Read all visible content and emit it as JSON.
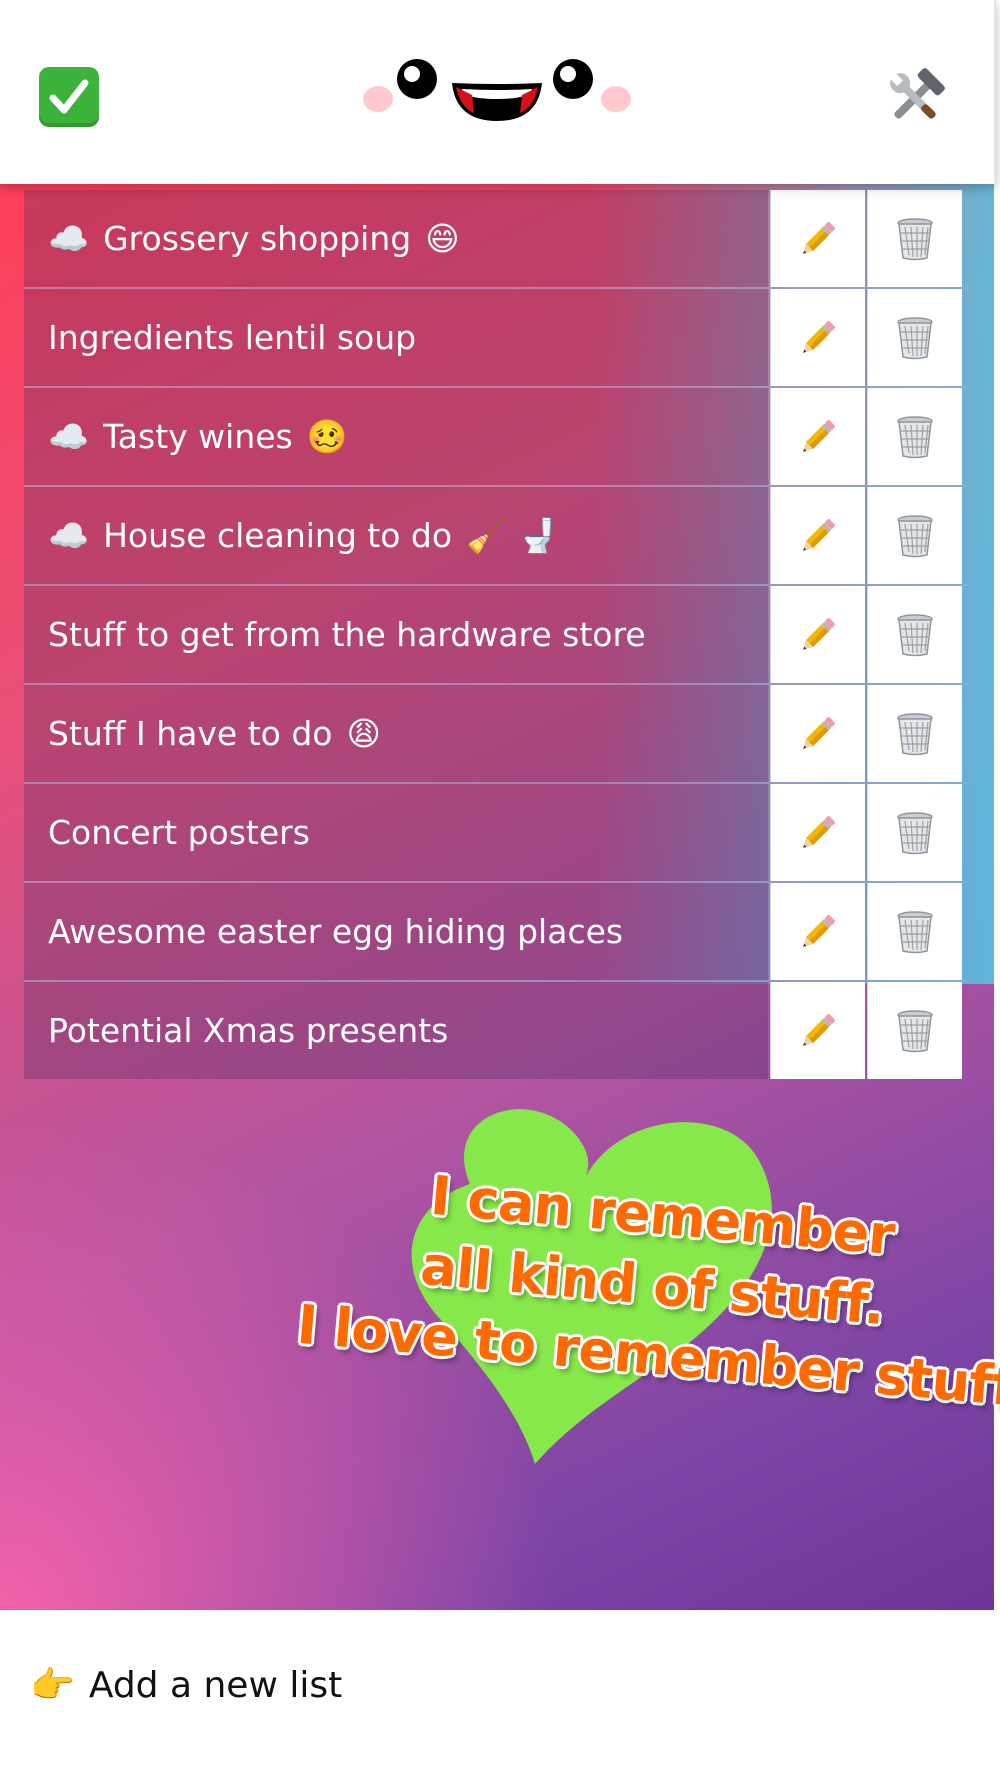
{
  "header": {
    "left_icon": "check-mark-button-icon",
    "center_icon": "smiley-face-logo",
    "right_icon": "hammer-and-wrench-icon"
  },
  "lists": [
    {
      "prefix": "☁️",
      "title": "Grossery shopping",
      "suffix": "😄"
    },
    {
      "prefix": "",
      "title": "Ingredients lentil soup",
      "suffix": ""
    },
    {
      "prefix": "☁️",
      "title": "Tasty wines",
      "suffix": "🥴"
    },
    {
      "prefix": "☁️",
      "title": "House cleaning to do",
      "suffix": "🧹 🚽"
    },
    {
      "prefix": "",
      "title": "Stuff to get from the hardware store",
      "suffix": ""
    },
    {
      "prefix": "",
      "title": "Stuff I have to do",
      "suffix": "😩"
    },
    {
      "prefix": "",
      "title": "Concert posters",
      "suffix": ""
    },
    {
      "prefix": "",
      "title": "Awesome easter egg hiding places",
      "suffix": ""
    },
    {
      "prefix": "",
      "title": "Potential Xmas presents",
      "suffix": ""
    }
  ],
  "row_actions": {
    "edit_icon": "pencil-icon",
    "delete_icon": "wastebasket-icon"
  },
  "promo": {
    "line1": "I can remember",
    "line2": "all kind of stuff.",
    "line3": "I love to remember stuff"
  },
  "footer": {
    "add_label": "Add a new list",
    "add_icon": "👉"
  },
  "colors": {
    "heart": "#86e84a",
    "promo_text": "#ff6a00",
    "check": "#3bb33b"
  }
}
